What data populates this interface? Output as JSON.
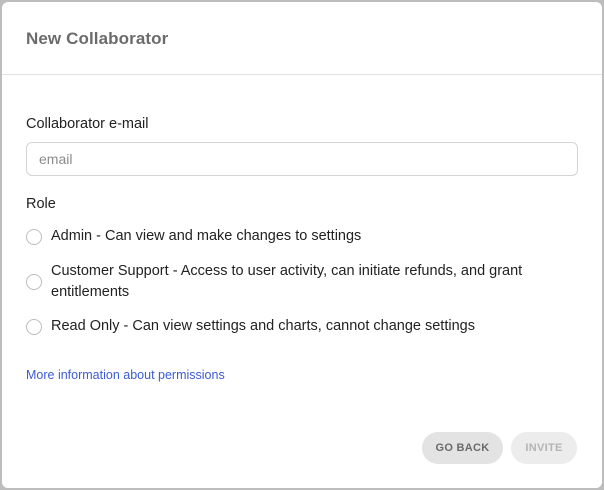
{
  "dialog": {
    "title": "New Collaborator"
  },
  "email": {
    "label": "Collaborator e-mail",
    "value": "",
    "placeholder": "email"
  },
  "role": {
    "label": "Role",
    "options": [
      {
        "label": "Admin - Can view and make changes to settings",
        "selected": false
      },
      {
        "label": "Customer Support - Access to user activity, can initiate refunds, and grant entitlements",
        "selected": false
      },
      {
        "label": "Read Only - Can view settings and charts, cannot change settings",
        "selected": false
      }
    ]
  },
  "permissions_link": "More information about permissions",
  "buttons": {
    "go_back": "GO BACK",
    "invite": "INVITE"
  },
  "colors": {
    "link": "#3c5bd6",
    "button_bg": "#e3e3e3",
    "title": "#6b6b6b"
  }
}
